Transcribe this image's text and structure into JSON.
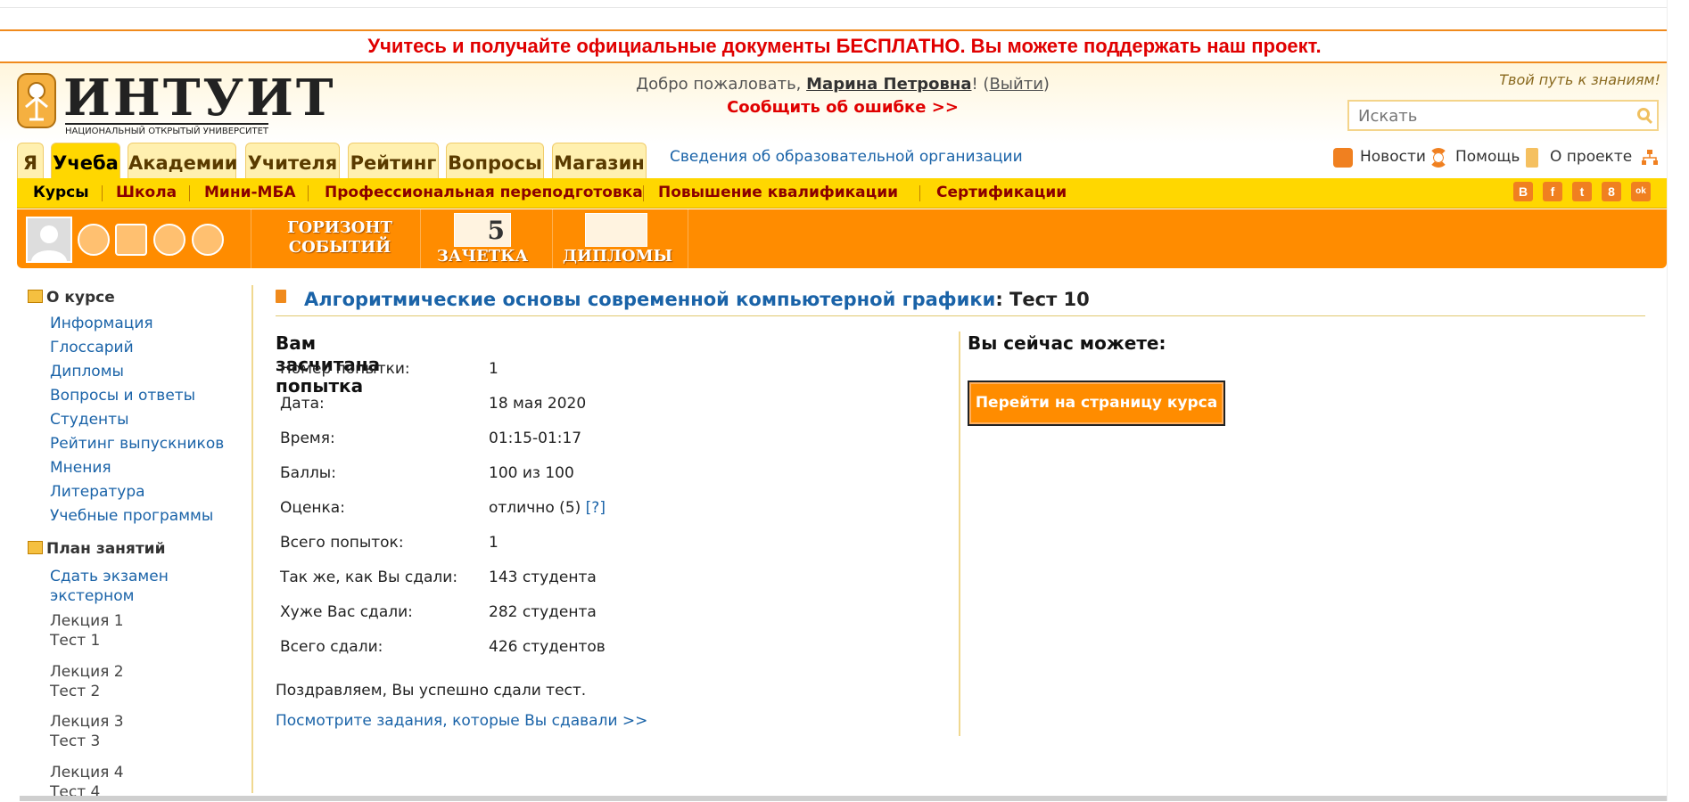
{
  "promo": "Учитесь и получайте официальные документы БЕСПЛАТНО. Вы можете поддержать наш проект.",
  "logo": {
    "name": "ИНТУИТ",
    "subtitle": "НАЦИОНАЛЬНЫЙ ОТКРЫТЫЙ УНИВЕРСИТЕТ"
  },
  "welcome": {
    "prefix": "Добро пожаловать,",
    "user": "Марина Петровна",
    "excl": "!",
    "logout": "Выйти"
  },
  "report_error": "Сообщить об ошибке >>",
  "slogan": "Твой путь к знаниям!",
  "search": {
    "placeholder": "Искать"
  },
  "tabs": [
    {
      "label": "Я",
      "active": false
    },
    {
      "label": "Учеба",
      "active": true
    },
    {
      "label": "Академии",
      "active": false
    },
    {
      "label": "Учителя",
      "active": false
    },
    {
      "label": "Рейтинг",
      "active": false
    },
    {
      "label": "Вопросы",
      "active": false
    },
    {
      "label": "Магазин",
      "active": false
    }
  ],
  "org_link": "Сведения об образовательной организации",
  "top_links": {
    "news": "Новости",
    "help": "Помощь",
    "about": "О проекте"
  },
  "subnav": [
    "Курсы",
    "Школа",
    "Мини-МБА",
    "Профессиональная переподготовка",
    "Повышение квалификации",
    "Сертификации"
  ],
  "social": [
    "В",
    "f",
    "t",
    "8",
    "ok"
  ],
  "toolbar": {
    "events_line1": "ГОРИЗОНТ",
    "events_line2": "СОБЫТИЙ",
    "gradebook": "ЗАЧЕТКА",
    "diplomas": "ДИПЛОМЫ",
    "gradebook_mark": "5"
  },
  "sidebar": {
    "about_header": "О курсе",
    "about_items": [
      "Информация",
      "Глоссарий",
      "Дипломы",
      "Вопросы и ответы",
      "Студенты",
      "Рейтинг выпускников",
      "Мнения",
      "Литература",
      "Учебные программы"
    ],
    "plan_header": "План занятий",
    "exam_line1": "Сдать экзамен",
    "exam_line2": "экстерном",
    "lectures": [
      {
        "lecture": "Лекция 1",
        "test": "Тест 1"
      },
      {
        "lecture": "Лекция 2",
        "test": "Тест 2"
      },
      {
        "lecture": "Лекция 3",
        "test": "Тест 3"
      },
      {
        "lecture": "Лекция 4",
        "test": "Тест 4"
      }
    ]
  },
  "main": {
    "course_title": "Алгоритмические основы современной компьютерной графики",
    "test_suffix": ": Тест 10",
    "attempt_header": "Вам засчитана попытка",
    "rows": [
      {
        "label": "Номер попытки:",
        "value": "1"
      },
      {
        "label": "Дата:",
        "value": "18 мая 2020"
      },
      {
        "label": "Время:",
        "value": "01:15-01:17"
      },
      {
        "label": "Баллы:",
        "value": "100 из 100"
      },
      {
        "label": "Оценка:",
        "value": "отлично (5)",
        "help": "[?]"
      },
      {
        "label": "Всего попыток:",
        "value": "1"
      },
      {
        "label": "Так же, как Вы сдали:",
        "value": "143 студента"
      },
      {
        "label": "Хуже Вас сдали:",
        "value": "282 студента"
      },
      {
        "label": "Всего сдали:",
        "value": "426 студентов"
      }
    ],
    "congrats": "Поздравляем, Вы успешно сдали тест.",
    "view_tasks": "Посмотрите задания, которые Вы сдавали >>",
    "right_header": "Вы сейчас можете:",
    "go_button": "Перейти на страницу курса"
  },
  "colors": {
    "accent": "#ff8c00",
    "nav_yellow": "#ffd700",
    "link": "#1a63a8",
    "alert": "#e00000"
  }
}
